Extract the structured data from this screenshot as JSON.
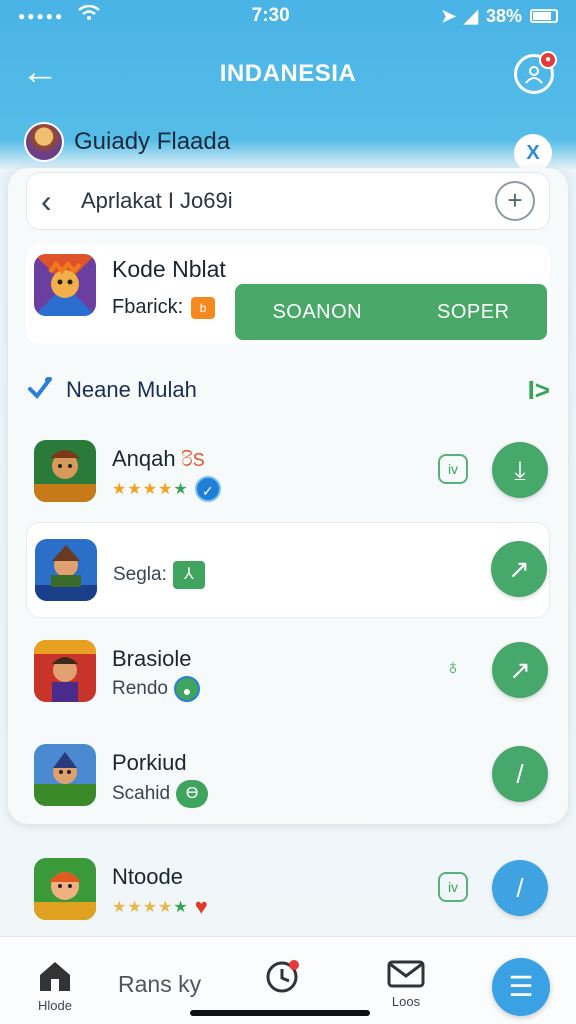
{
  "status_bar": {
    "time": "7:30",
    "battery": "38%"
  },
  "header": {
    "title": "INDANESIA",
    "back_glyph": "←",
    "profile_badge": "●"
  },
  "user": {
    "name": "Guiady Flaada",
    "close_glyph": "X"
  },
  "search": {
    "value": "Aprlakat I Jo69i",
    "plus_glyph": "+"
  },
  "featured": {
    "name": "Kode Nblat",
    "sub": "Fbarick:",
    "badge": "b",
    "buttons": [
      "SOANON",
      "SOPER"
    ]
  },
  "section": {
    "title": "Neane Mulah",
    "arrow": "I>"
  },
  "rows": [
    {
      "name": "Anqah",
      "tag": "රිS",
      "stars": "★★★★",
      "star_green": "★",
      "badge": "✓",
      "side": "iv",
      "action": "⤓"
    },
    {
      "name": "",
      "sub": "Segla:",
      "badge": "⅄",
      "action": "↗"
    },
    {
      "name": "Brasiole",
      "sub": "Rendo",
      "badge": "●",
      "side": "♁",
      "action": "↗"
    },
    {
      "name": "Porkiud",
      "sub": "Scahid",
      "badge": "Ɵ",
      "action": "/"
    },
    {
      "name": "Ntoode",
      "stars": "★★★★",
      "star_green": "★",
      "badge": "♥",
      "side": "iv",
      "action": "/"
    }
  ],
  "bottom_nav": {
    "home_label": "Hlode",
    "middle_text": "Rans ky",
    "logs_label": "Loos",
    "fab": "☰"
  },
  "colors": {
    "accent": "#49b3e6",
    "green": "#46a86a",
    "blue": "#3ea3e0"
  },
  "icons": [
    "back-arrow-icon",
    "profile-icon",
    "search-back-icon",
    "plus-icon",
    "check-icon",
    "clock-icon",
    "mail-icon",
    "home-icon",
    "menu-icon"
  ]
}
